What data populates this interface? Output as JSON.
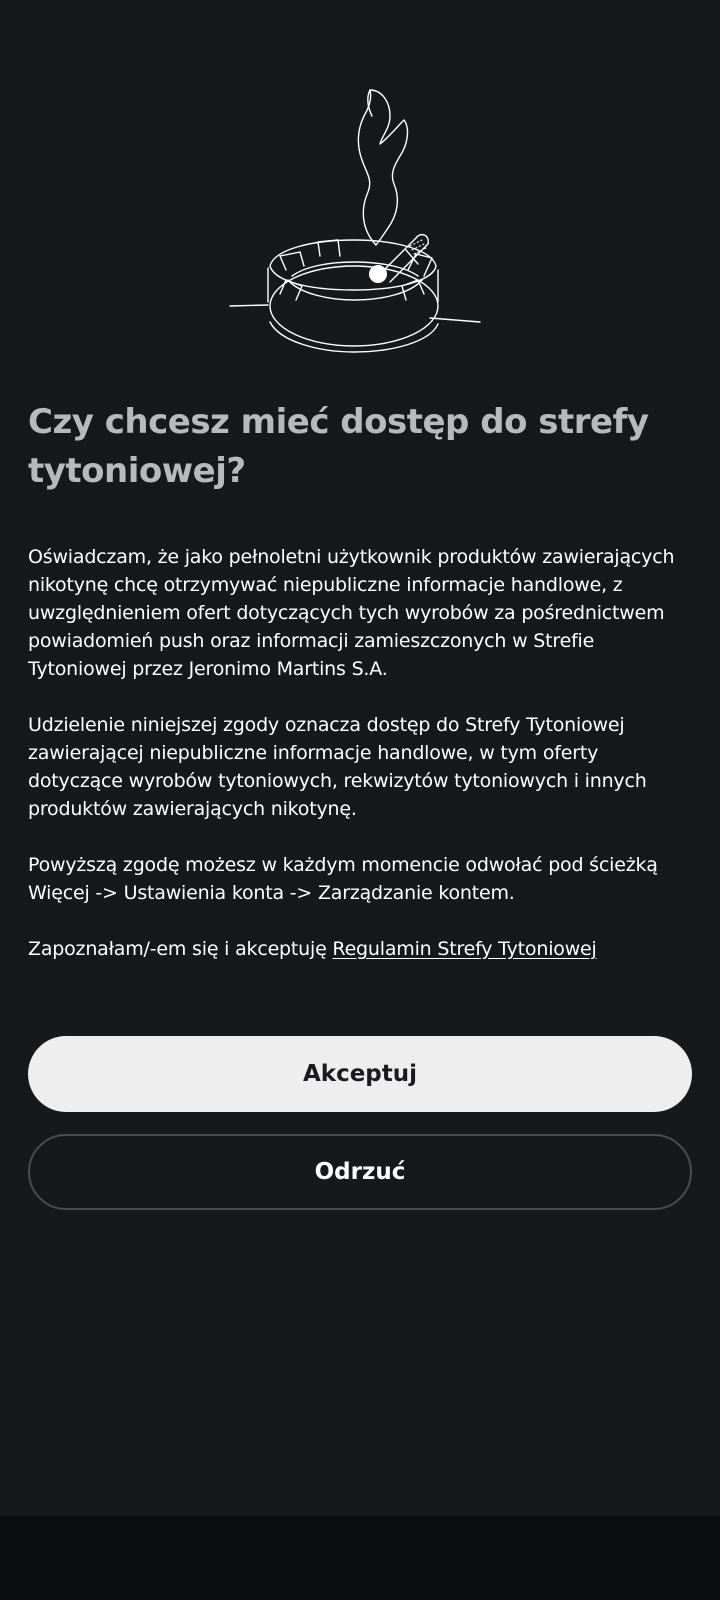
{
  "illustration": {
    "icon": "ashtray-cigarette-icon"
  },
  "title": "Czy chcesz mieć dostęp do strefy tytoniowej?",
  "paragraphs": {
    "p1": "Oświadczam, że jako pełnoletni użytkownik produktów zawierających nikotynę chcę otrzymywać niepubliczne informacje handlowe, z uwzględnieniem ofert dotyczących tych wyrobów za pośrednictwem powiadomień push oraz informacji zamieszczonych w Strefie Tytoniowej przez Jeronimo Martins S.A.",
    "p2": "Udzielenie niniejszej zgody oznacza dostęp do Strefy Tytoniowej zawierającej niepubliczne informacje handlowe, w tym oferty dotyczące wyrobów tytoniowych, rekwizytów tytoniowych i innych produktów zawierających nikotynę.",
    "p3": "Powyższą zgodę możesz w każdym momencie odwołać pod ścieżką Więcej -> Ustawienia konta -> Zarządzanie kontem.",
    "p4_prefix": "Zapoznałam/-em się i akceptuję ",
    "p4_link": "Regulamin Strefy Tytoniowej"
  },
  "buttons": {
    "accept_label": "Akceptuj",
    "reject_label": "Odrzuć"
  },
  "colors": {
    "background": "#17181c",
    "title": "#b8b9bd",
    "accept_bg": "#eeeeee",
    "accept_text": "#1b1b1f",
    "reject_border": "#4a4b50",
    "bottom_bar": "#0c0d10"
  }
}
